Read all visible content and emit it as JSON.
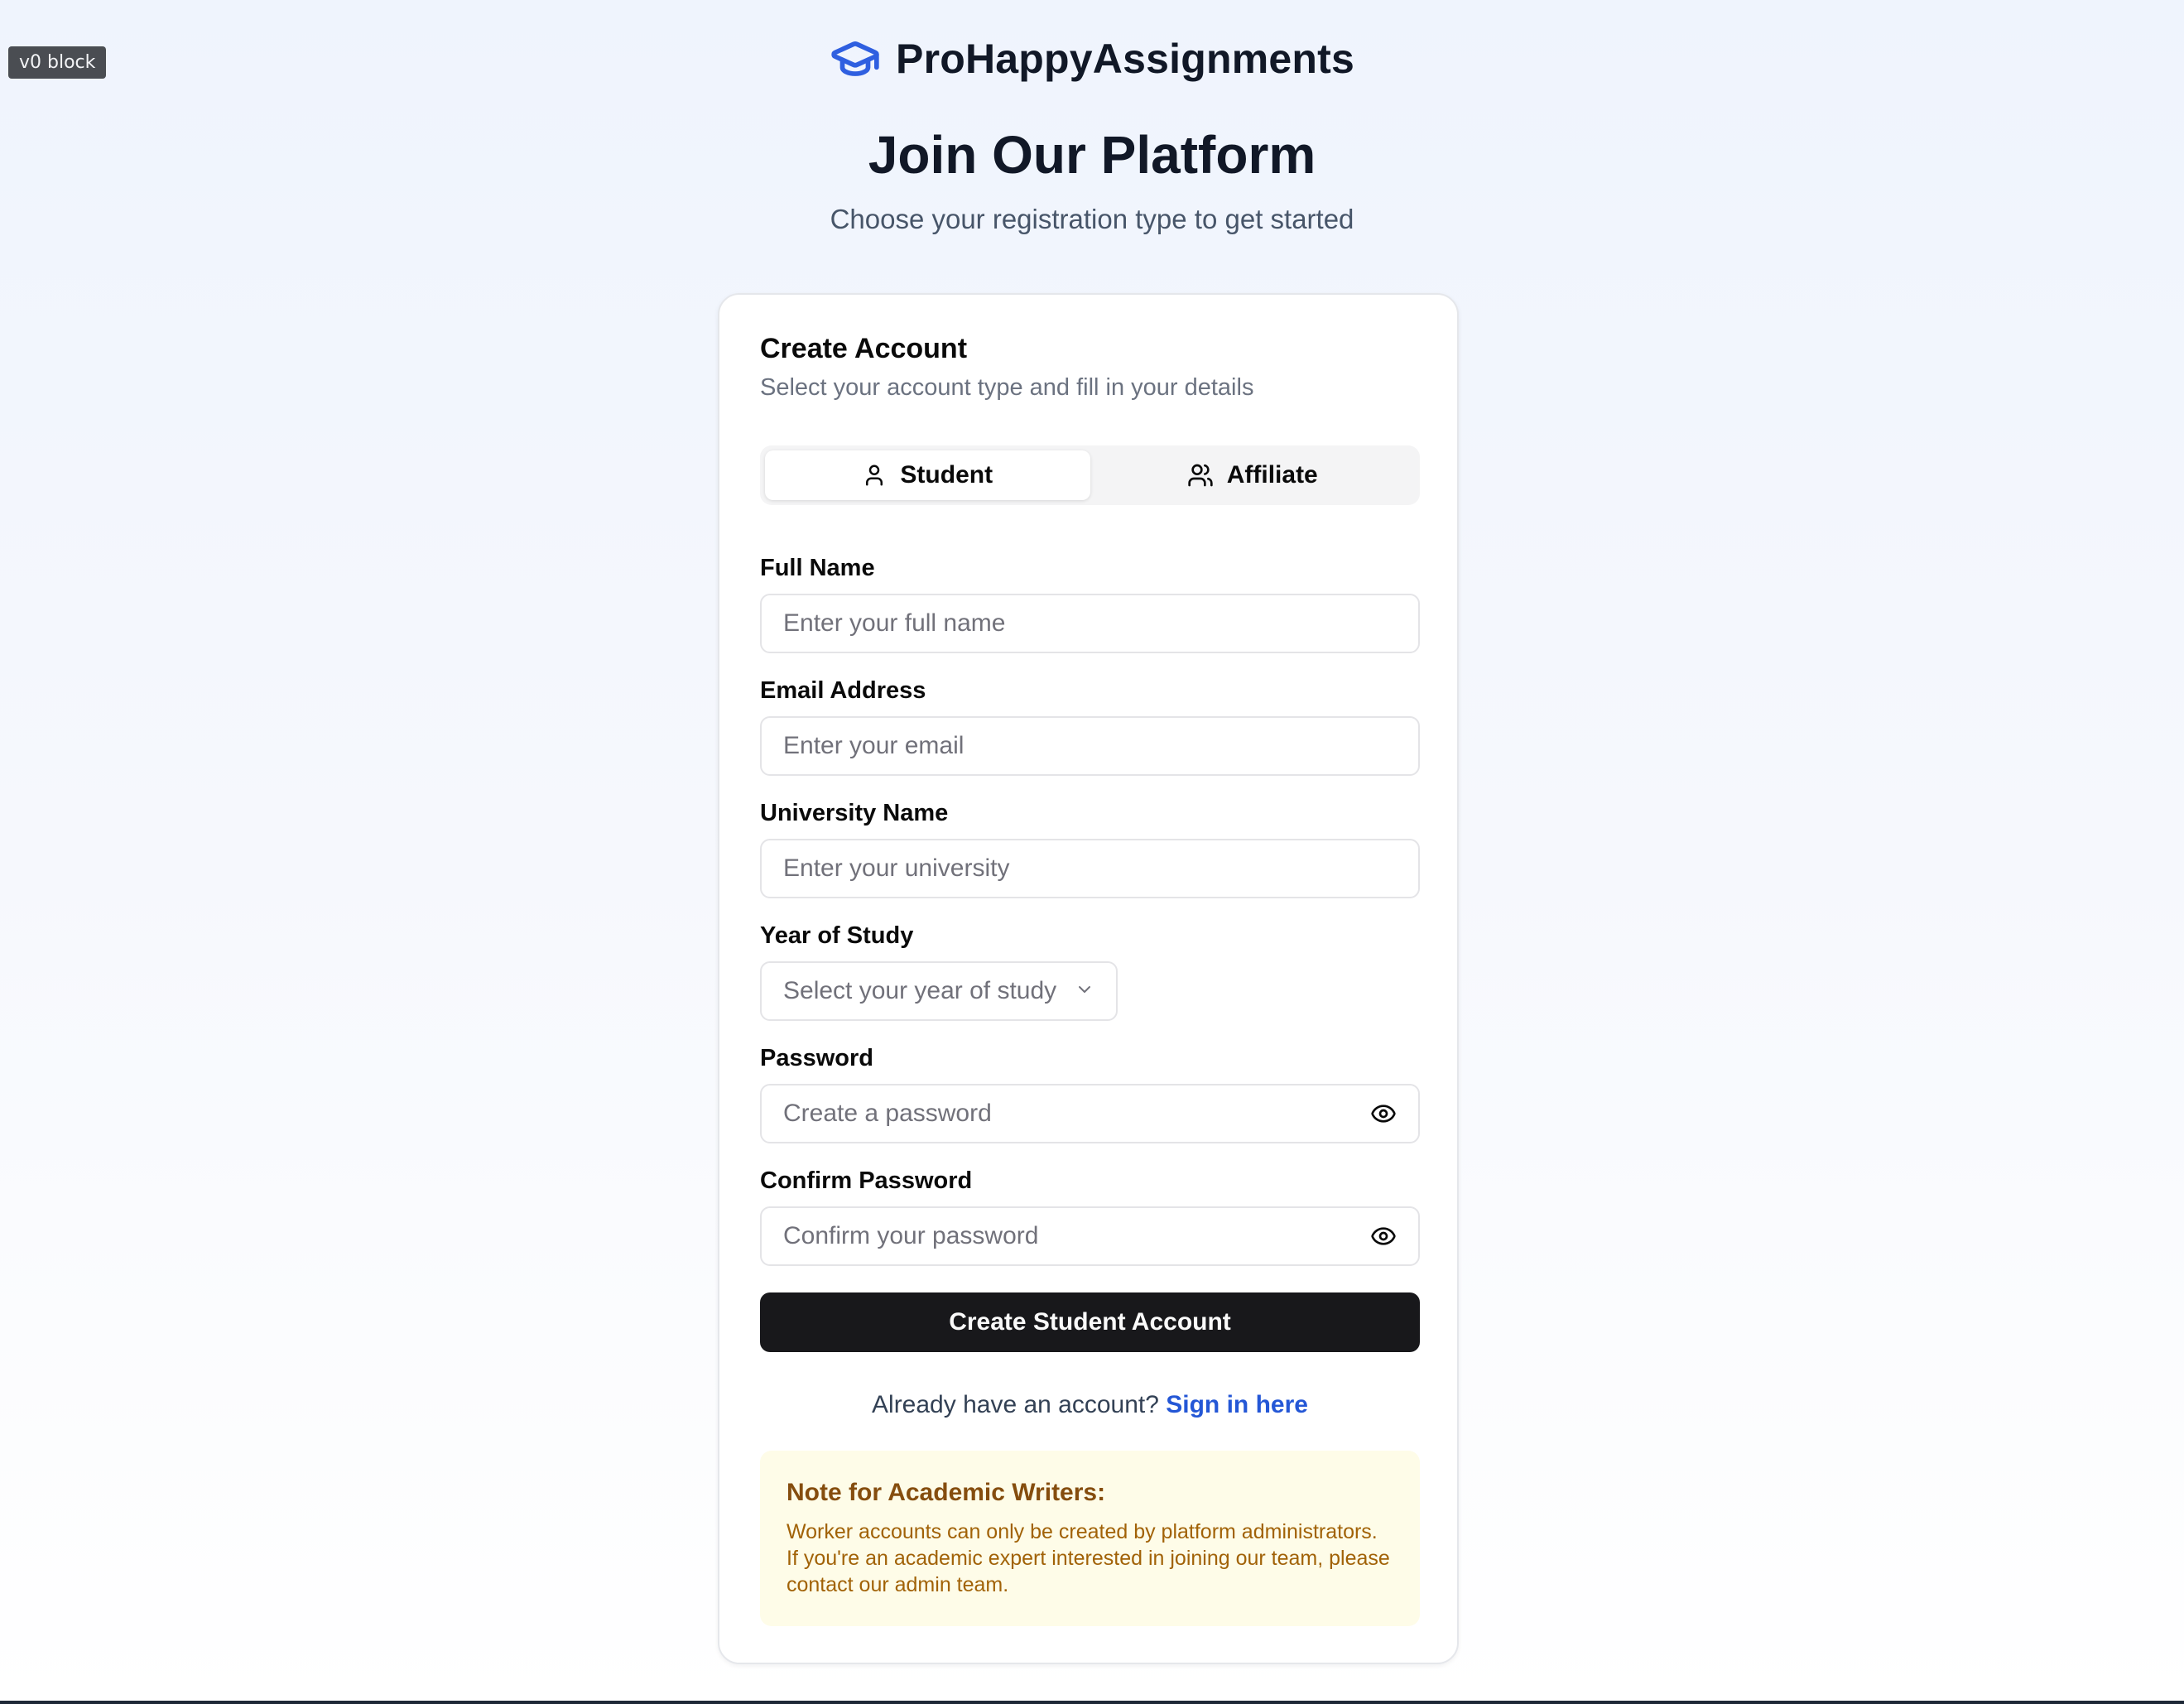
{
  "badge": "v0 block",
  "brand": {
    "name": "ProHappyAssignments",
    "icon": "graduation-cap-icon",
    "icon_color": "#2f5fe0"
  },
  "header": {
    "title": "Join Our Platform",
    "subtitle": "Choose your registration type to get started"
  },
  "card": {
    "title": "Create Account",
    "description": "Select your account type and fill in your details",
    "tabs": [
      {
        "label": "Student",
        "icon": "user-icon",
        "active": true
      },
      {
        "label": "Affiliate",
        "icon": "users-icon",
        "active": false
      }
    ]
  },
  "form": {
    "full_name": {
      "label": "Full Name",
      "placeholder": "Enter your full name"
    },
    "email": {
      "label": "Email Address",
      "placeholder": "Enter your email"
    },
    "university": {
      "label": "University Name",
      "placeholder": "Enter your university"
    },
    "year": {
      "label": "Year of Study",
      "placeholder": "Select your year of study"
    },
    "password": {
      "label": "Password",
      "placeholder": "Create a password"
    },
    "confirm_password": {
      "label": "Confirm Password",
      "placeholder": "Confirm your password"
    },
    "submit_label": "Create Student Account"
  },
  "signin": {
    "prompt": "Already have an account?",
    "link": "Sign in here"
  },
  "note": {
    "title": "Note for Academic Writers:",
    "body": "Worker accounts can only be created by platform administrators. If you're an academic expert interested in joining our team, please contact our admin team."
  },
  "colors": {
    "link": "#2457d6",
    "primary_button": "#18181b",
    "note_bg": "#fefce8",
    "note_title": "#854d0e",
    "note_text": "#a16207"
  }
}
